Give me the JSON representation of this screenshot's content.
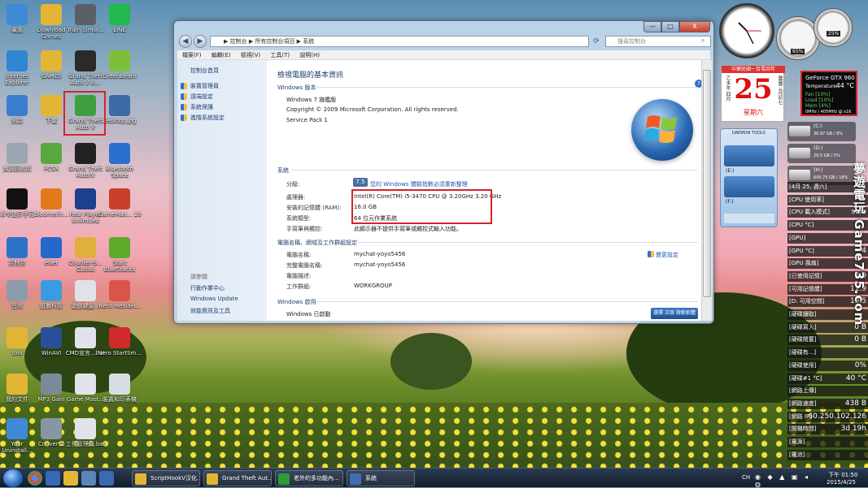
{
  "desktop": {
    "icons": [
      {
        "label": "電腦",
        "color": "#3e8ad6"
      },
      {
        "label": "Download Games",
        "color": "#e2b634"
      },
      {
        "label": "Train Simul...",
        "color": "#5a6066"
      },
      {
        "label": "LINE",
        "color": "#22b84c"
      },
      {
        "label": "Internet Explorer",
        "color": "#2f86d1"
      },
      {
        "label": "GAMES",
        "color": "#e2b634"
      },
      {
        "label": "Grand Theft Auto V U...",
        "color": "#2a2a2a"
      },
      {
        "label": "GreenBeam",
        "color": "#7cbf3a"
      },
      {
        "label": "網路",
        "color": "#3b7ed0"
      },
      {
        "label": "下載",
        "color": "#e2b634"
      },
      {
        "label": "Grand Theft Auto V",
        "color": "#3e9f3e"
      },
      {
        "label": "desktop.jpg",
        "color": "#3a6aa8"
      },
      {
        "label": "資源回收筒",
        "color": "#9aa6b2"
      },
      {
        "label": "PCSX",
        "color": "#58a83d"
      },
      {
        "label": "Grand Theft AutoIV",
        "color": "#222"
      },
      {
        "label": "Bluetooth Space",
        "color": "#2a6fd0"
      },
      {
        "label": "命令提示字元",
        "color": "#111"
      },
      {
        "label": "Bloomerin...",
        "color": "#e07a1c"
      },
      {
        "label": "Real Player Unlimited",
        "color": "#1e3e8e"
      },
      {
        "label": "GameMax... 10",
        "color": "#c9402a"
      },
      {
        "label": "控制台",
        "color": "#2b73c7"
      },
      {
        "label": "eNet",
        "color": "#2468c9"
      },
      {
        "label": "Counter-S... Global",
        "color": "#e0b03a"
      },
      {
        "label": "Start BlueStacks",
        "color": "#5eaa2a"
      },
      {
        "label": "音效",
        "color": "#8c9bab"
      },
      {
        "label": "凱撒科技",
        "color": "#3a9ce0"
      },
      {
        "label": "遊戲鍵盤...",
        "color": "#dfe3e8"
      },
      {
        "label": "Nero MediaH...",
        "color": "#d9554a"
      },
      {
        "label": "tool",
        "color": "#e2b634"
      },
      {
        "label": "WinAVI",
        "color": "#2a4f9a"
      },
      {
        "label": "CMD宣言...bat",
        "color": "#e0e4ea"
      },
      {
        "label": "Nero StartSm...",
        "color": "#d12a2a"
      },
      {
        "label": "我的文件",
        "color": "#e2b634"
      },
      {
        "label": "MP3 Gain",
        "color": "#7a8a9a"
      },
      {
        "label": "Game Mast...",
        "color": "#e0e4ea"
      },
      {
        "label": "裝置和印表機",
        "color": "#d8dde3"
      },
      {
        "label": "Your Uninstall...",
        "color": "#3e8ad6"
      },
      {
        "label": "ConvertZ",
        "color": "#8896a4"
      },
      {
        "label": "工作管理員.bat",
        "color": "#e0e4ea"
      }
    ]
  },
  "window": {
    "title_controls": {
      "minimize": "—",
      "maximize": "□",
      "close": "X"
    },
    "nav": {
      "back": "◀",
      "forward": "▶"
    },
    "address": "▶ 控制台 ▶ 所有控制台項目 ▶ 系統",
    "search_placeholder": "搜尋控制台",
    "menu": [
      "檔案(F)",
      "編輯(E)",
      "檢視(V)",
      "工具(T)",
      "說明(H)"
    ],
    "left_pane": {
      "home": "控制台首頁",
      "links": [
        "裝置管理員",
        "遠端設定",
        "系統保護",
        "進階系統設定"
      ],
      "see_also_title": "請參閱",
      "see_also": [
        "行動作業中心",
        "Windows Update",
        "效能資訊及工具"
      ]
    },
    "page_title": "檢視電腦的基本資訊",
    "edition_section": "Windows 版本",
    "edition": "Windows 7 旗艦版",
    "copyright": "Copyright © 2009 Microsoft Corporation. All rights reserved.",
    "service_pack": "Service Pack 1",
    "system_section": "系統",
    "rows": [
      {
        "label": "分級:",
        "value": "您的 Windows 體驗指數必須重新整理"
      },
      {
        "label": "處理器:",
        "value": "Intel(R) Core(TM) i5-3470 CPU @ 3.20GHz   3.20 GHz"
      },
      {
        "label": "安裝的記憶體 (RAM):",
        "value": "16.0 GB"
      },
      {
        "label": "系統類型:",
        "value": "64 位元作業系統"
      },
      {
        "label": "手寫筆與觸控:",
        "value": "此顯示器不提供手寫筆或觸控式輸入功能。"
      }
    ],
    "rating_badge": "7.5",
    "computer_section": "電腦名稱、網域及工作群組設定",
    "computer_rows": [
      {
        "label": "電腦名稱:",
        "value": "mychat-yoyo5456"
      },
      {
        "label": "完整電腦名稱:",
        "value": "mychat-yoyo5456"
      },
      {
        "label": "電腦描述:",
        "value": ""
      },
      {
        "label": "工作群組:",
        "value": "WORKGROUP"
      }
    ],
    "change_settings": "變更設定",
    "activation_section": "Windows 啟用",
    "activation_status": "Windows 已啟動",
    "genuine_badge": "選擇 正版 微軟軟體",
    "help_icon": "?"
  },
  "gadgets": {
    "calendar": {
      "header": "中華民國一百零四年",
      "day": "25",
      "weekday": "星期六",
      "left": "乙未年 四月",
      "right": "農曆三月初七"
    },
    "gpu": {
      "name": "GeForce GTX 960",
      "temperature_label": "Temperature:",
      "temperature": "44 °C",
      "fan": "Fan [10%]",
      "load": "Load [10%]",
      "mem": "Mem [4%]",
      "clock": "0MHz / 405MHz @ x16"
    },
    "meter": {
      "left_pct": "65%",
      "right_pct": "25%"
    },
    "daemon": {
      "title": "DAEMON TOOLS",
      "drive1": "(E:)",
      "drive2": "(F:)"
    },
    "drives": [
      {
        "label": "(C:)",
        "info": "36.97 GB / 8%"
      },
      {
        "label": "(D:)",
        "info": "29.5 GB / 5%"
      },
      {
        "label": "(H:)",
        "info": "645.75 GB / 18%"
      }
    ],
    "sidebar_rows": [
      {
        "label": "[4月 25, 週六]",
        "value": "1"
      },
      {
        "label": "[CPU 使用率]",
        "value": ""
      },
      {
        "label": "[CPU 載入模式]",
        "value": "side"
      },
      {
        "label": "[CPU °C]",
        "value": ""
      },
      {
        "label": "[GPU]",
        "value": ""
      },
      {
        "label": "[GPU °C]",
        "value": "4"
      },
      {
        "label": "[GPU 風扇]",
        "value": ""
      },
      {
        "label": "[已使用記憶]",
        "value": "3.9"
      },
      {
        "label": "[可用記憶體]",
        "value": "11.9"
      },
      {
        "label": "[D: 可用空間]",
        "value": "19.5"
      },
      {
        "label": "[硬碟讀取]",
        "value": ""
      },
      {
        "label": "[硬碟寫入]",
        "value": "0 B"
      },
      {
        "label": "[硬碟閒置]",
        "value": "0 B"
      },
      {
        "label": "[硬碟有...]",
        "value": ""
      },
      {
        "label": "[硬碟使用]",
        "value": "0%"
      },
      {
        "label": "[硬碟#1 °C]",
        "value": "40 °C"
      },
      {
        "label": "[網路上傳]",
        "value": ""
      },
      {
        "label": "[網路速度]",
        "value": "438 B"
      },
      {
        "label": "[網路 IP]",
        "value": "60.250.102.126"
      },
      {
        "label": "[開機時間]",
        "value": "3d 19h"
      },
      {
        "label": "[電源]",
        "value": ""
      },
      {
        "label": "[電池]",
        "value": ""
      }
    ],
    "watermark": "夢遊電玩 Game735.com"
  },
  "taskbar": {
    "items": [
      {
        "label": "ScriptHookV汉化...",
        "color": "#e2b634"
      },
      {
        "label": "Grand Theft Aut...",
        "color": "#e2b634"
      },
      {
        "label": "老外的多功能內...",
        "color": "#2d9a3c"
      },
      {
        "label": "系統",
        "color": "#3e6fb0"
      }
    ],
    "tray_lang": "CH",
    "time": "下午 01:50",
    "date": "2015/4/25"
  }
}
